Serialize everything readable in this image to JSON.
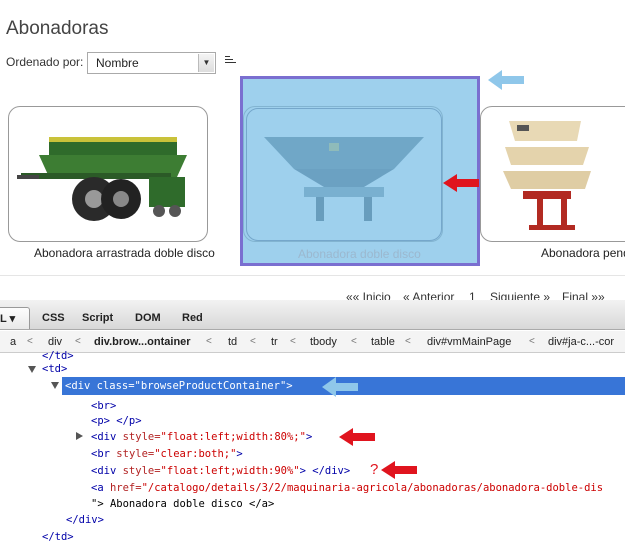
{
  "page": {
    "title": "Abonadoras",
    "order_label": "Ordenado por:",
    "order_value": "Nombre",
    "products": [
      {
        "name": "Abonadora arrastrada doble disco"
      },
      {
        "name": "Abonadora doble disco"
      },
      {
        "name": "Abonadora pend"
      }
    ],
    "pager": {
      "first": "«« Inicio",
      "prev": "« Anterior",
      "page": "1",
      "next": "Siguiente »",
      "last": "Final »»"
    }
  },
  "devtools": {
    "tabs": [
      "L ▾",
      "CSS",
      "Script",
      "DOM",
      "Red"
    ],
    "breadcrumb": [
      "a",
      "div",
      "div.brow...ontainer",
      "td",
      "tr",
      "tbody",
      "table",
      "div#vmMainPage",
      "div#ja-c...-cor"
    ],
    "html_lines": [
      {
        "indent": 0,
        "tag_open": "</td>",
        "attr": "",
        "val": "",
        "rest": ""
      },
      {
        "indent": 0,
        "tag_open": "<td>",
        "attr": "",
        "val": "",
        "rest": ""
      },
      {
        "indent": 1,
        "tag_open": "<div ",
        "attr": "class=",
        "val": "\"browseProductContainer\"",
        "rest": ">"
      },
      {
        "indent": 2,
        "tag_open": "<br>",
        "attr": "",
        "val": "",
        "rest": ""
      },
      {
        "indent": 2,
        "tag_open": "<p> </p>",
        "attr": "",
        "val": "",
        "rest": ""
      },
      {
        "indent": 2,
        "tag_open": "<div ",
        "attr": "style=",
        "val": "\"float:left;width:80%;\"",
        "rest": ">"
      },
      {
        "indent": 2,
        "tag_open": "<br ",
        "attr": "style=",
        "val": "\"clear:both;\"",
        "rest": ">"
      },
      {
        "indent": 2,
        "tag_open": "<div ",
        "attr": "style=",
        "val": "\"float:left;width:90%\"",
        "rest": "> </div>"
      },
      {
        "indent": 2,
        "tag_open": "<a ",
        "attr": "href=",
        "val": "\"/catalogo/details/3/2/maquinaria-agricola/abonadoras/abonadora-doble-dis",
        "rest": ""
      },
      {
        "indent": 2,
        "tag_open": "",
        "attr": "",
        "val": "",
        "rest": "\"> Abonadora doble disco </a>"
      },
      {
        "indent": 1,
        "tag_open": "</div>",
        "attr": "",
        "val": "",
        "rest": ""
      },
      {
        "indent": 0,
        "tag_open": "</td>",
        "attr": "",
        "val": "",
        "rest": ""
      }
    ],
    "question_mark": "?"
  },
  "colors": {
    "highlight_fill": "#78bee6",
    "highlight_border": "#7a6fd0",
    "selected_row": "#3875d7",
    "red_arrow": "#e0141e",
    "blue_arrow": "#8fc7ea"
  }
}
